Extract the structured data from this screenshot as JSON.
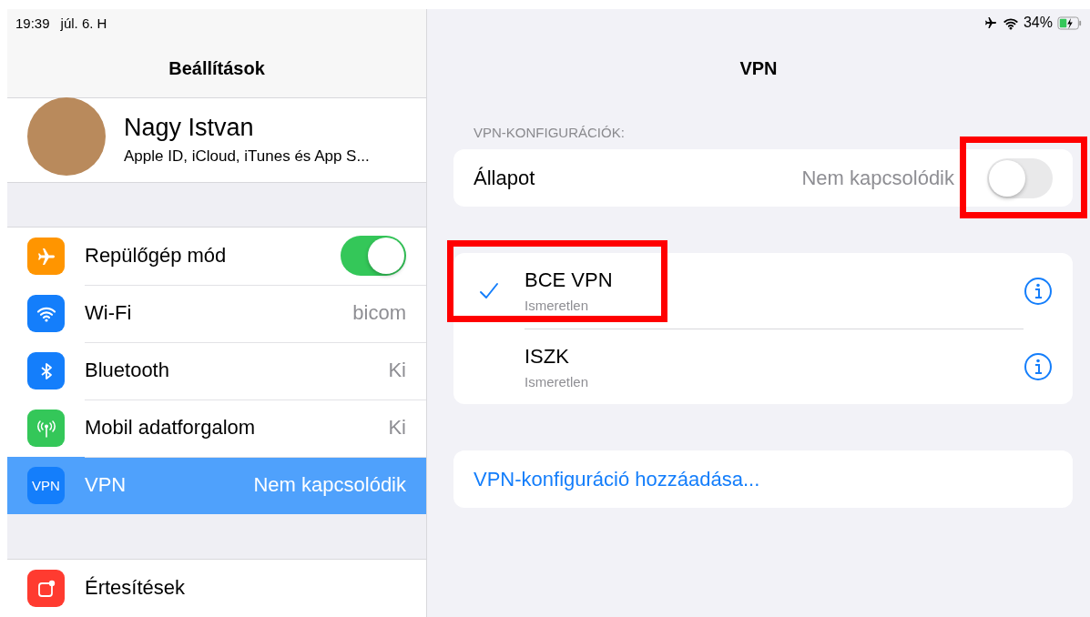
{
  "status_bar": {
    "time": "19:39",
    "date": "júl. 6. H",
    "battery": "34%"
  },
  "sidebar": {
    "title": "Beállítások",
    "profile": {
      "name": "Nagy Istvan",
      "subtitle": "Apple ID, iCloud, iTunes és App S..."
    },
    "groups": [
      [
        {
          "kind": "toggle",
          "label": "Repülőgép mód",
          "on": true,
          "selected": false,
          "color": "#ff9500"
        },
        {
          "kind": "value",
          "label": "Wi-Fi",
          "value": "bicom",
          "selected": false,
          "color": "#147efb"
        },
        {
          "kind": "value",
          "label": "Bluetooth",
          "value": "Ki",
          "selected": false,
          "color": "#147efb"
        },
        {
          "kind": "value",
          "label": "Mobil adatforgalom",
          "value": "Ki",
          "selected": false,
          "color": "#34c759"
        },
        {
          "kind": "value",
          "icon_text": "VPN",
          "label": "VPN",
          "value": "Nem kapcsolódik",
          "selected": true,
          "color": "#147efb"
        }
      ],
      [
        {
          "kind": "value",
          "label": "Értesítések",
          "selected": false,
          "color": "#ff3b30"
        }
      ]
    ]
  },
  "detail": {
    "title": "VPN",
    "section_header": "VPN-KONFIGURÁCIÓK:",
    "status": {
      "label": "Állapot",
      "value": "Nem kapcsolódik",
      "on": false
    },
    "configs": [
      {
        "name": "BCE VPN",
        "status": "Ismeretlen",
        "selected": true
      },
      {
        "name": "ISZK",
        "status": "Ismeretlen",
        "selected": false
      }
    ],
    "add_link": "VPN-konfiguráció hozzáadása..."
  }
}
